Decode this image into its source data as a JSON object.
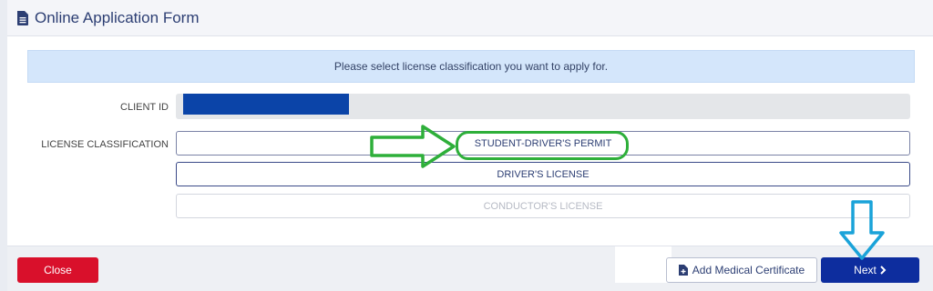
{
  "header": {
    "title": "Online Application Form",
    "icon": "document-icon"
  },
  "notice": {
    "text": "Please select license classification you want to apply for."
  },
  "client": {
    "label": "CLIENT ID",
    "value_redacted": true
  },
  "license": {
    "label": "LICENSE CLASSIFICATION",
    "options": [
      {
        "label": "STUDENT-DRIVER'S PERMIT",
        "highlighted": true
      },
      {
        "label": "DRIVER'S LICENSE",
        "selected": true
      },
      {
        "label": "CONDUCTOR'S LICENSE",
        "disabled": true
      }
    ]
  },
  "footer": {
    "close_label": "Close",
    "medical_label": "Add Medical Certificate",
    "next_label": "Next"
  },
  "colors": {
    "accent": "#0d2d9e",
    "danger": "#d9102b",
    "annotation_green": "#2eaf3a",
    "annotation_blue": "#1aa3d9",
    "notice_bg": "#d4e6fb"
  }
}
